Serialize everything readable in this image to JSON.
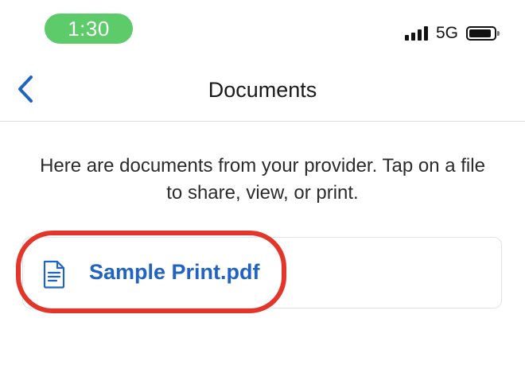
{
  "status_bar": {
    "time": "1:30",
    "network": "5G",
    "icons": [
      "signal-icon",
      "battery-icon"
    ],
    "colors": {
      "time_pill": "#5ecb6b"
    }
  },
  "nav": {
    "title": "Documents",
    "back_icon": "chevron-left-icon"
  },
  "main": {
    "intro_text": "Here are documents from your provider. Tap on a file to share, view, or print.",
    "documents": [
      {
        "name": "Sample Print.pdf",
        "icon": "document-icon"
      }
    ]
  },
  "colors": {
    "accent": "#1f63c4",
    "highlight": "#e4352a"
  }
}
